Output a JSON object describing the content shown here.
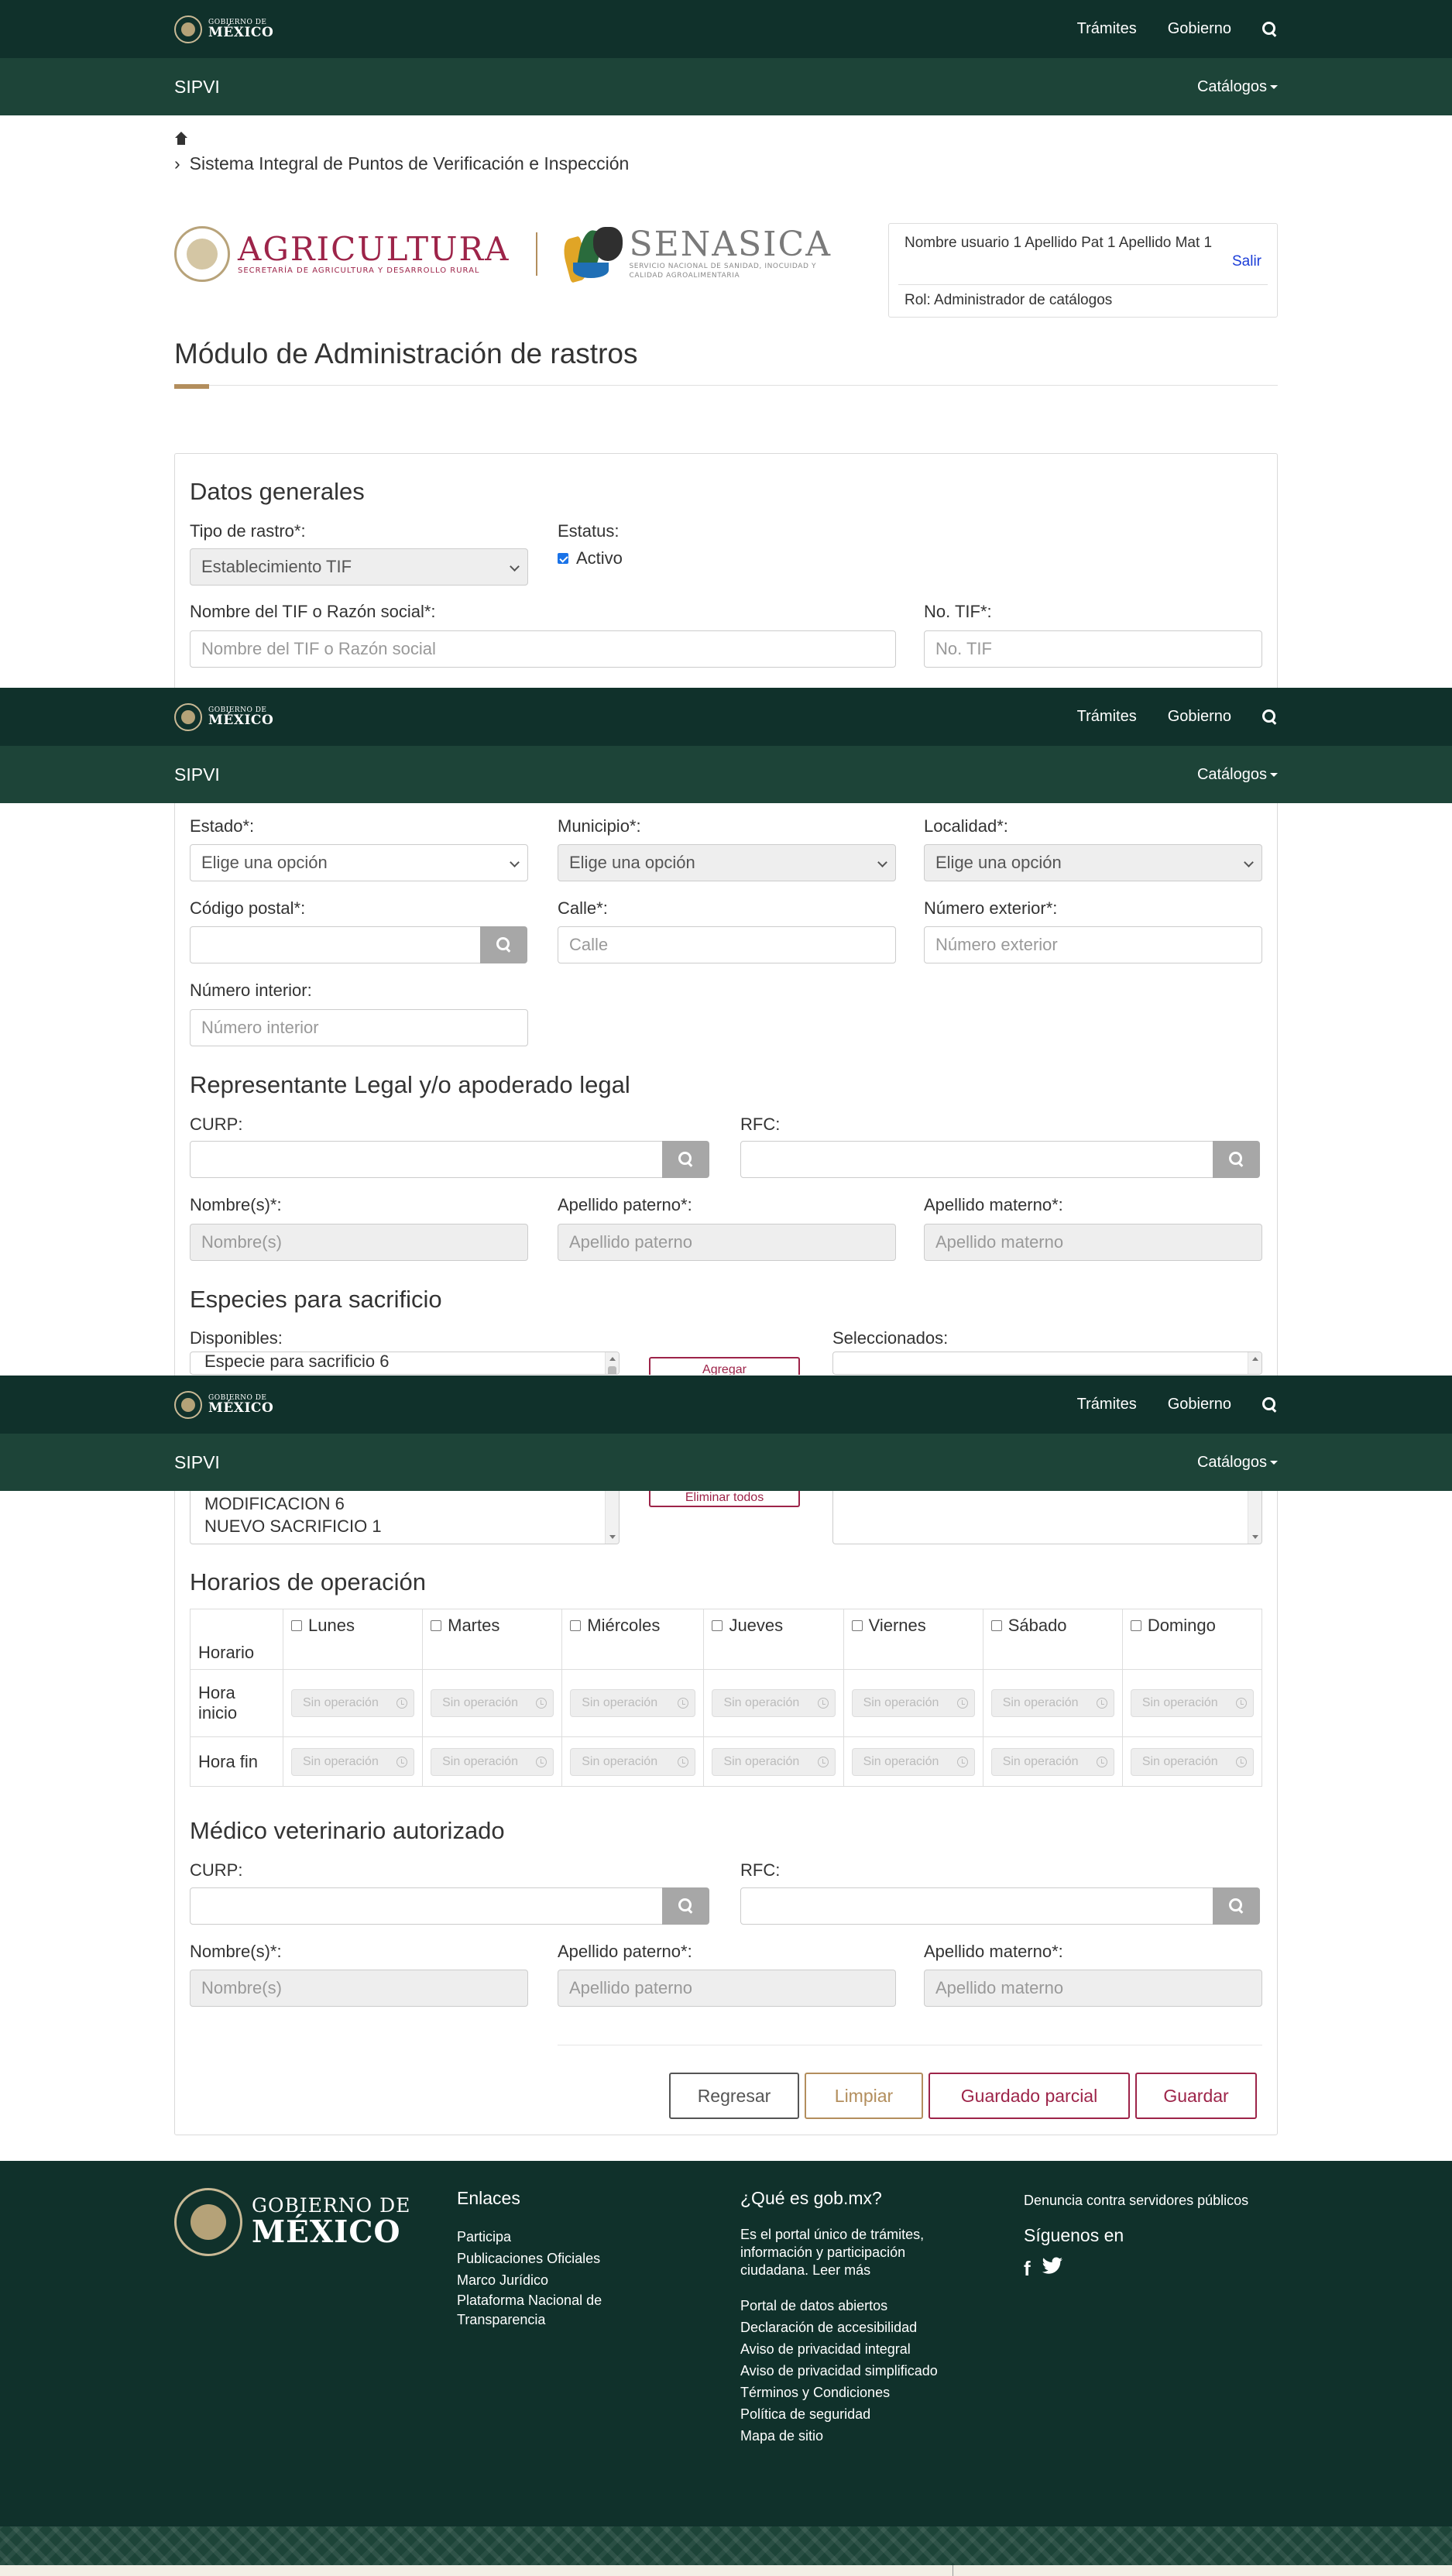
{
  "gob_header": {
    "logo_top": "GOBIERNO DE",
    "logo_bottom": "MÉXICO",
    "nav": [
      "Trámites",
      "Gobierno"
    ]
  },
  "sub_header": {
    "title": "SIPVI",
    "menu": "Catálogos"
  },
  "breadcrumb": {
    "current": "Sistema Integral de Puntos de Verificación e Inspección"
  },
  "brand": {
    "agri_title": "AGRICULTURA",
    "agri_subtitle": "SECRETARÍA DE AGRICULTURA Y DESARROLLO RURAL",
    "senasica_title": "SENASICA",
    "senasica_subtitle": "SERVICIO NACIONAL DE SANIDAD, INOCUIDAD Y CALIDAD AGROALIMENTARIA"
  },
  "user": {
    "name": "Nombre usuario 1 Apellido Pat 1 Apellido Mat 1",
    "logout": "Salir",
    "role": "Rol: Administrador de catálogos"
  },
  "page_title": "Módulo de Administración de rastros",
  "general": {
    "title": "Datos generales",
    "tipo_label": "Tipo de rastro*:",
    "tipo_value": "Establecimiento TIF",
    "status_label": "Estatus:",
    "status_value": "Activo",
    "status_checked": true,
    "nombre_label": "Nombre del TIF o Razón social*:",
    "nombre_placeholder": "Nombre del TIF o Razón social",
    "tif_label": "No. TIF*:",
    "tif_placeholder": "No. TIF"
  },
  "address": {
    "estado_label": "Estado*:",
    "estado_value": "Elige una opción",
    "municipio_label": "Municipio*:",
    "municipio_value": "Elige una opción",
    "localidad_label": "Localidad*:",
    "localidad_value": "Elige una opción",
    "cp_label": "Código postal*:",
    "calle_label": "Calle*:",
    "calle_placeholder": "Calle",
    "num_ext_label": "Número exterior*:",
    "num_ext_placeholder": "Número exterior",
    "num_int_label": "Número interior:",
    "num_int_placeholder": "Número interior"
  },
  "legal_rep": {
    "title": "Representante Legal y/o apoderado legal",
    "curp_label": "CURP:",
    "rfc_label": "RFC:",
    "nombre_label": "Nombre(s)*:",
    "nombre_placeholder": "Nombre(s)",
    "paterno_label": "Apellido paterno*:",
    "paterno_placeholder": "Apellido paterno",
    "materno_label": "Apellido materno*:",
    "materno_placeholder": "Apellido materno"
  },
  "species": {
    "title": "Especies para sacrificio",
    "available_label": "Disponibles:",
    "selected_label": "Seleccionados:",
    "available_top_visible": [
      "Especie para sacrificio 6"
    ],
    "available_bottom_visible": [
      "MODIFICACION 6",
      "NUEVO SACRIFICIO 1"
    ],
    "add_button": "Agregar",
    "remove_all_button": "Eliminar todos"
  },
  "hours": {
    "title": "Horarios de operación",
    "col_header": "Horario",
    "days": [
      "Lunes",
      "Martes",
      "Miércoles",
      "Jueves",
      "Viernes",
      "Sábado",
      "Domingo"
    ],
    "start_label": "Hora inicio",
    "end_label": "Hora fin",
    "placeholder": "Sin operación"
  },
  "vet": {
    "title": "Médico veterinario autorizado",
    "curp_label": "CURP:",
    "rfc_label": "RFC:",
    "nombre_label": "Nombre(s)*:",
    "nombre_placeholder": "Nombre(s)",
    "paterno_label": "Apellido paterno*:",
    "paterno_placeholder": "Apellido paterno",
    "materno_label": "Apellido materno*:",
    "materno_placeholder": "Apellido materno"
  },
  "actions": {
    "back": "Regresar",
    "clear": "Limpiar",
    "partial": "Guardado parcial",
    "save": "Guardar"
  },
  "footer": {
    "logo_top": "GOBIERNO DE",
    "logo_bottom": "MÉXICO",
    "links_title": "Enlaces",
    "links": [
      "Participa",
      "Publicaciones Oficiales",
      "Marco Jurídico",
      "Plataforma Nacional de Transparencia"
    ],
    "about_title": "¿Qué es gob.mx?",
    "about_text": "Es el portal único de trámites, información y participación ciudadana. Leer más",
    "about_links": [
      "Portal de datos abiertos",
      "Declaración de accesibilidad",
      "Aviso de privacidad integral",
      "Aviso de privacidad simplificado",
      "Términos y Condiciones",
      "Política de seguridad",
      "Mapa de sitio"
    ],
    "report": "Denuncia contra servidores públicos",
    "follow": "Síguenos en"
  },
  "colors": {
    "gob_dark": "#10312b",
    "gob_green": "#1d4438",
    "guinda": "#9d2449",
    "gold": "#b38e5d"
  }
}
